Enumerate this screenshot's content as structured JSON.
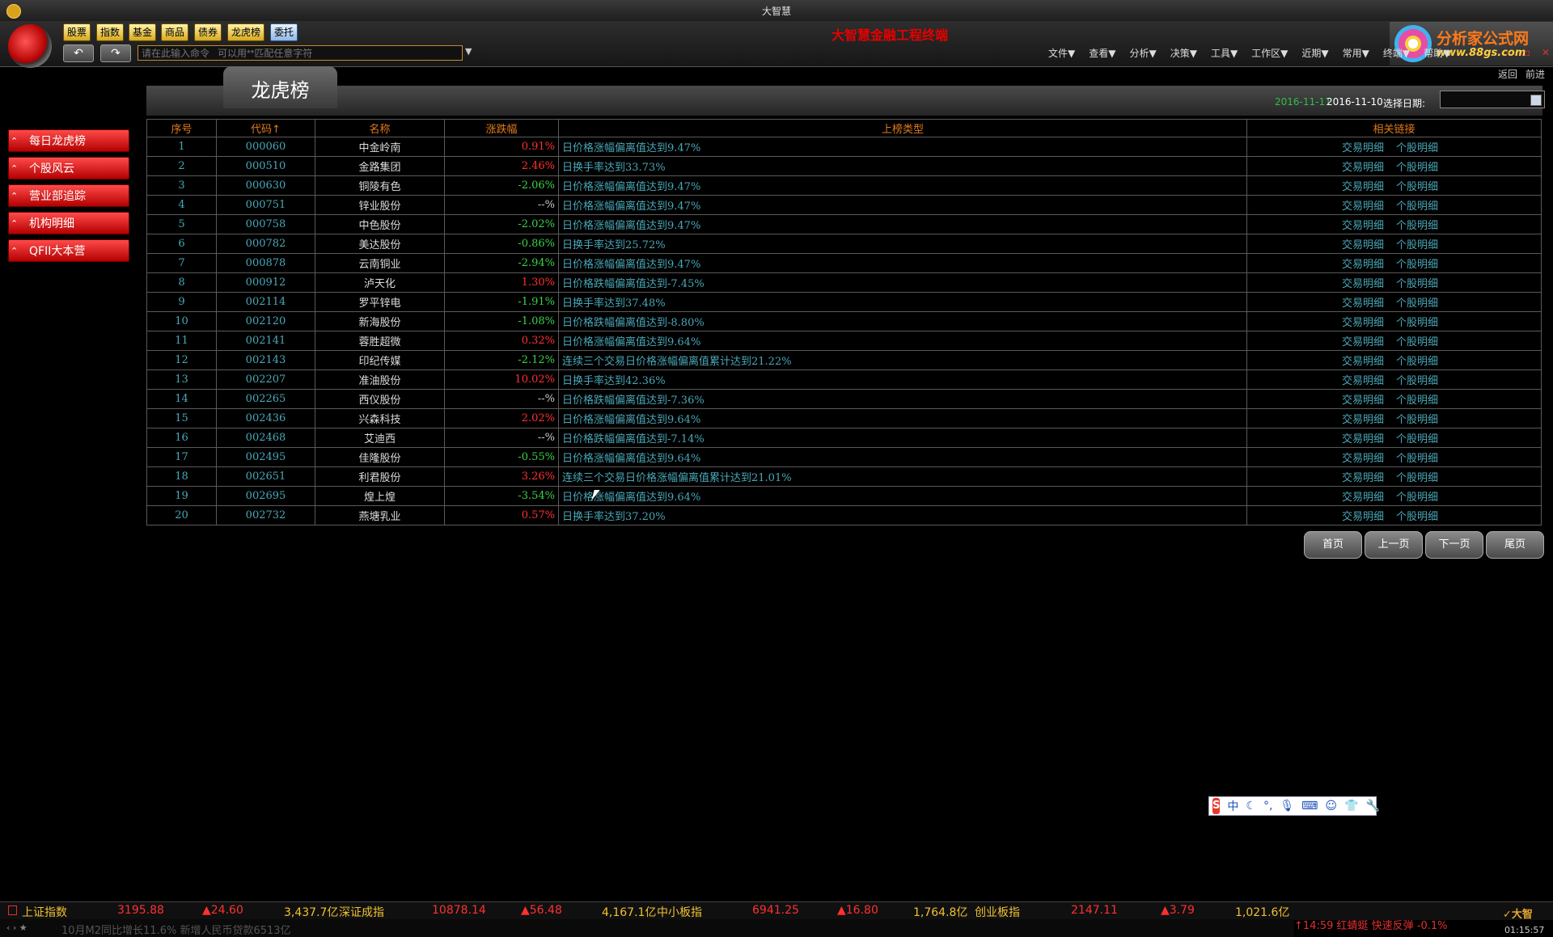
{
  "window": {
    "title": "大智慧"
  },
  "header": {
    "quick_buttons": [
      "股票",
      "指数",
      "基金",
      "商品",
      "债券",
      "龙虎榜",
      "委托"
    ],
    "command_placeholder": "请在此输入命令   可以用**匹配任意字符",
    "app_title": "大智慧金融工程终端",
    "brand": {
      "name": "分析家公式网",
      "url": "www.88gs.com"
    },
    "menu": [
      "文件▼",
      "查看▼",
      "分析▼",
      "决策▼",
      "工具▼",
      "工作区▼",
      "近期▼",
      "常用▼",
      "终端▼",
      "帮助▼"
    ]
  },
  "nav": {
    "back": "返回",
    "forward": "前进"
  },
  "sidebar": {
    "items": [
      {
        "label": "每日龙虎榜"
      },
      {
        "label": "个股风云"
      },
      {
        "label": "营业部追踪"
      },
      {
        "label": "机构明细"
      },
      {
        "label": "QFII大本营"
      }
    ]
  },
  "panel": {
    "title": "龙虎榜",
    "date_latest": "2016-11-11",
    "date_current": "2016-11-10",
    "date_label": "选择日期:"
  },
  "table": {
    "headers": [
      "序号",
      "代码↑",
      "名称",
      "涨跌幅",
      "上榜类型",
      "相关链接"
    ],
    "link_labels": [
      "交易明细",
      "个股明细"
    ],
    "rows": [
      {
        "idx": "1",
        "code": "000060",
        "name": "中金岭南",
        "pct": "0.91%",
        "dir": "up",
        "type": "日价格涨幅偏离值达到9.47%"
      },
      {
        "idx": "2",
        "code": "000510",
        "name": "金路集团",
        "pct": "2.46%",
        "dir": "up",
        "type": "日换手率达到33.73%"
      },
      {
        "idx": "3",
        "code": "000630",
        "name": "铜陵有色",
        "pct": "-2.06%",
        "dir": "down",
        "type": "日价格涨幅偏离值达到9.47%"
      },
      {
        "idx": "4",
        "code": "000751",
        "name": "锌业股份",
        "pct": "--%",
        "dir": "flat",
        "type": "日价格涨幅偏离值达到9.47%"
      },
      {
        "idx": "5",
        "code": "000758",
        "name": "中色股份",
        "pct": "-2.02%",
        "dir": "down",
        "type": "日价格涨幅偏离值达到9.47%"
      },
      {
        "idx": "6",
        "code": "000782",
        "name": "美达股份",
        "pct": "-0.86%",
        "dir": "down",
        "type": "日换手率达到25.72%"
      },
      {
        "idx": "7",
        "code": "000878",
        "name": "云南铜业",
        "pct": "-2.94%",
        "dir": "down",
        "type": "日价格涨幅偏离值达到9.47%"
      },
      {
        "idx": "8",
        "code": "000912",
        "name": "泸天化",
        "pct": "1.30%",
        "dir": "up",
        "type": "日价格跌幅偏离值达到-7.45%"
      },
      {
        "idx": "9",
        "code": "002114",
        "name": "罗平锌电",
        "pct": "-1.91%",
        "dir": "down",
        "type": "日换手率达到37.48%"
      },
      {
        "idx": "10",
        "code": "002120",
        "name": "新海股份",
        "pct": "-1.08%",
        "dir": "down",
        "type": "日价格跌幅偏离值达到-8.80%"
      },
      {
        "idx": "11",
        "code": "002141",
        "name": "蓉胜超微",
        "pct": "0.32%",
        "dir": "up",
        "type": "日价格涨幅偏离值达到9.64%"
      },
      {
        "idx": "12",
        "code": "002143",
        "name": "印纪传媒",
        "pct": "-2.12%",
        "dir": "down",
        "type": "连续三个交易日价格涨幅偏离值累计达到21.22%"
      },
      {
        "idx": "13",
        "code": "002207",
        "name": "准油股份",
        "pct": "10.02%",
        "dir": "up",
        "type": "日换手率达到42.36%"
      },
      {
        "idx": "14",
        "code": "002265",
        "name": "西仪股份",
        "pct": "--%",
        "dir": "flat",
        "type": "日价格跌幅偏离值达到-7.36%"
      },
      {
        "idx": "15",
        "code": "002436",
        "name": "兴森科技",
        "pct": "2.02%",
        "dir": "up",
        "type": "日价格涨幅偏离值达到9.64%"
      },
      {
        "idx": "16",
        "code": "002468",
        "name": "艾迪西",
        "pct": "--%",
        "dir": "flat",
        "type": "日价格跌幅偏离值达到-7.14%"
      },
      {
        "idx": "17",
        "code": "002495",
        "name": "佳隆股份",
        "pct": "-0.55%",
        "dir": "down",
        "type": "日价格涨幅偏离值达到9.64%"
      },
      {
        "idx": "18",
        "code": "002651",
        "name": "利君股份",
        "pct": "3.26%",
        "dir": "up",
        "type": "连续三个交易日价格涨幅偏离值累计达到21.01%"
      },
      {
        "idx": "19",
        "code": "002695",
        "name": "煌上煌",
        "pct": "-3.54%",
        "dir": "down",
        "type": "日价格涨幅偏离值达到9.64%"
      },
      {
        "idx": "20",
        "code": "002732",
        "name": "燕塘乳业",
        "pct": "0.57%",
        "dir": "up",
        "type": "日换手率达到37.20%"
      }
    ]
  },
  "pager": {
    "first": "首页",
    "prev": "上一页",
    "next": "下一页",
    "last": "尾页"
  },
  "ime": {
    "logo": "S",
    "mode": "中"
  },
  "ticker": [
    {
      "name": "上证指数",
      "value": "3195.88",
      "change": "▲24.60",
      "volume": "3,437.7亿"
    },
    {
      "name": "深证成指",
      "value": "10878.14",
      "change": "▲56.48",
      "volume": "4,167.1亿"
    },
    {
      "name": "中小板指",
      "value": "6941.25",
      "change": "▲16.80",
      "volume": "1,764.8亿"
    },
    {
      "name": "创业板指",
      "value": "2147.11",
      "change": "▲3.79",
      "volume": "1,021.6亿"
    }
  ],
  "news": {
    "text": "10月M2同比增长11.6% 新增人民币贷款6513亿"
  },
  "alert": {
    "text": "14:59 红蜻蜓  快速反弹 -0.1%"
  },
  "clock": "01:15:57",
  "colors": {
    "up": "#ff3030",
    "down": "#3cd04a",
    "accent": "#e07a1a",
    "cyan": "#4aa8b8"
  }
}
